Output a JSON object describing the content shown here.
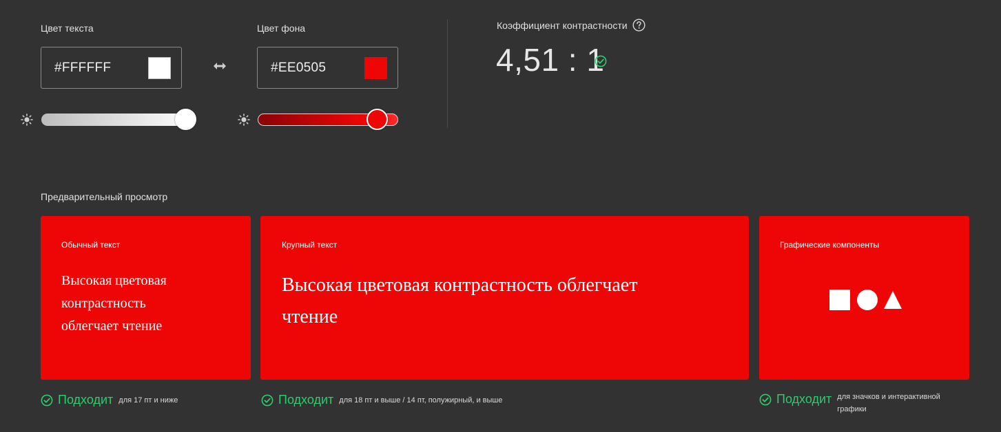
{
  "colors": {
    "background": "#323232",
    "text_color": "#FFFFFF",
    "background_color": "#EE0505",
    "success": "#2dcc6c"
  },
  "text_color": {
    "label": "Цвет текста",
    "hex": "#FFFFFF",
    "brightness_level": 1.0
  },
  "background_color": {
    "label": "Цвет фона",
    "hex": "#EE0505",
    "brightness_level": 0.85
  },
  "icons": {
    "swap": "swap-arrows-icon",
    "brightness": "sun-icon",
    "help": "question-circle-icon",
    "check": "check-circle-icon"
  },
  "contrast": {
    "label": "Коэффициент контрастности",
    "value": "4,51 : 1"
  },
  "preview": {
    "label": "Предварительный просмотр",
    "cards": [
      {
        "title": "Обычный текст",
        "sample_lines": [
          "Высокая цветовая",
          "контрастность",
          "облегчает чтение"
        ],
        "status": "Подходит",
        "note": "для 17 пт и ниже"
      },
      {
        "title": "Крупный текст",
        "sample_lines": [
          "Высокая цветовая контрастность облегчает",
          "чтение"
        ],
        "status": "Подходит",
        "note": "для 18 пт и выше / 14 пт, полужирный, и выше"
      },
      {
        "title": "Графические компоненты",
        "shapes": [
          "square",
          "circle",
          "triangle"
        ],
        "status": "Подходит",
        "note_lines": [
          "для значков и интерактивной",
          "графики"
        ]
      }
    ]
  }
}
